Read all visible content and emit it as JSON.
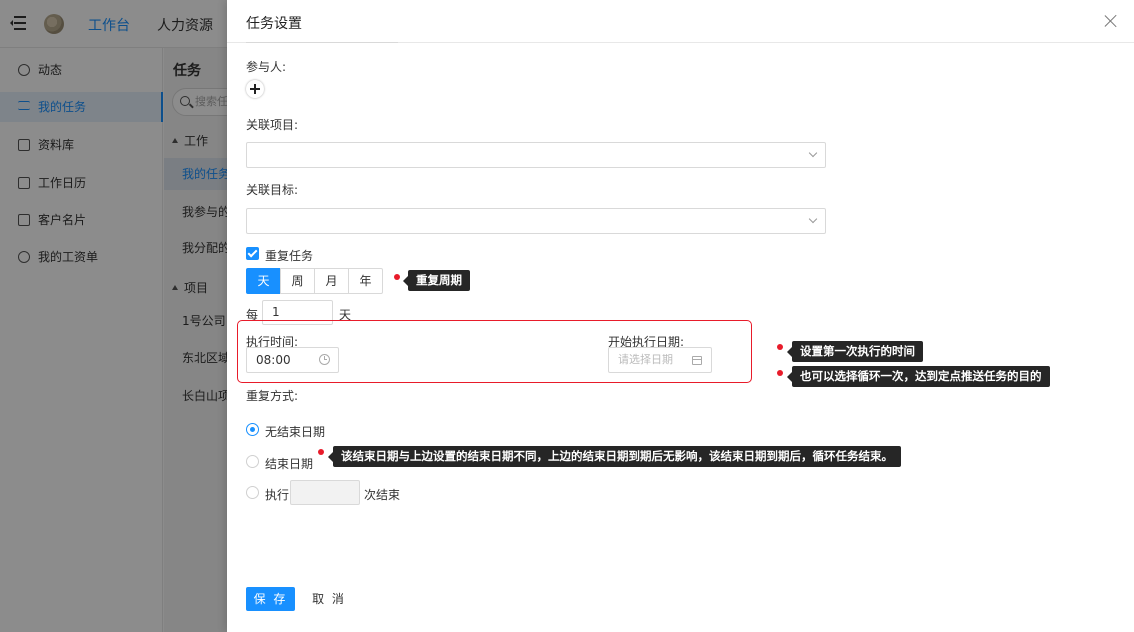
{
  "topnav": {
    "tabs": [
      "工作台",
      "人力资源"
    ]
  },
  "sidebar": {
    "items": [
      {
        "label": "动态",
        "icon": "dashboard-icon"
      },
      {
        "label": "我的任务",
        "icon": "list-icon",
        "active": true
      },
      {
        "label": "资料库",
        "icon": "folder-icon"
      },
      {
        "label": "工作日历",
        "icon": "calendar-icon"
      },
      {
        "label": "客户名片",
        "icon": "card-icon"
      },
      {
        "label": "我的工资单",
        "icon": "salary-icon"
      }
    ]
  },
  "secondary": {
    "title": "任务",
    "search_placeholder": "搜索任",
    "group_work": "工作",
    "work_items": [
      "我的任务",
      "我参与的",
      "我分配的"
    ],
    "group_project": "项目",
    "project_items": [
      "1号公司",
      "东北区域",
      "长白山项"
    ]
  },
  "drawer": {
    "title": "任务设置",
    "participants_label": "参与人:",
    "related_project_label": "关联项目:",
    "related_goal_label": "关联目标:",
    "repeat_task_label": "重复任务",
    "repeat_task_checked": true,
    "period_options": [
      "天",
      "周",
      "月",
      "年"
    ],
    "period_selected": "天",
    "every_prefix": "每",
    "every_value": "1",
    "every_suffix": "天",
    "exec_time_label": "执行时间:",
    "exec_time_value": "08:00",
    "start_date_label": "开始执行日期:",
    "start_date_placeholder": "请选择日期",
    "repeat_mode_label": "重复方式:",
    "repeat_modes": [
      "无结束日期",
      "结束日期",
      "执行"
    ],
    "repeat_mode_selected": "无结束日期",
    "times_suffix": "次结束",
    "save_label": "保 存",
    "cancel_label": "取 消"
  },
  "annotations": {
    "period": "重复周期",
    "first_time": "设置第一次执行的时间",
    "loop_once": "也可以选择循环一次，达到定点推送任务的目的",
    "end_date": "该结束日期与上边设置的结束日期不同，上边的结束日期到期后无影响，该结束日期到期后，循环任务结束。"
  },
  "colors": {
    "primary": "#1890ff",
    "annotation_red": "#e81b2a",
    "tooltip_bg": "#262626"
  }
}
